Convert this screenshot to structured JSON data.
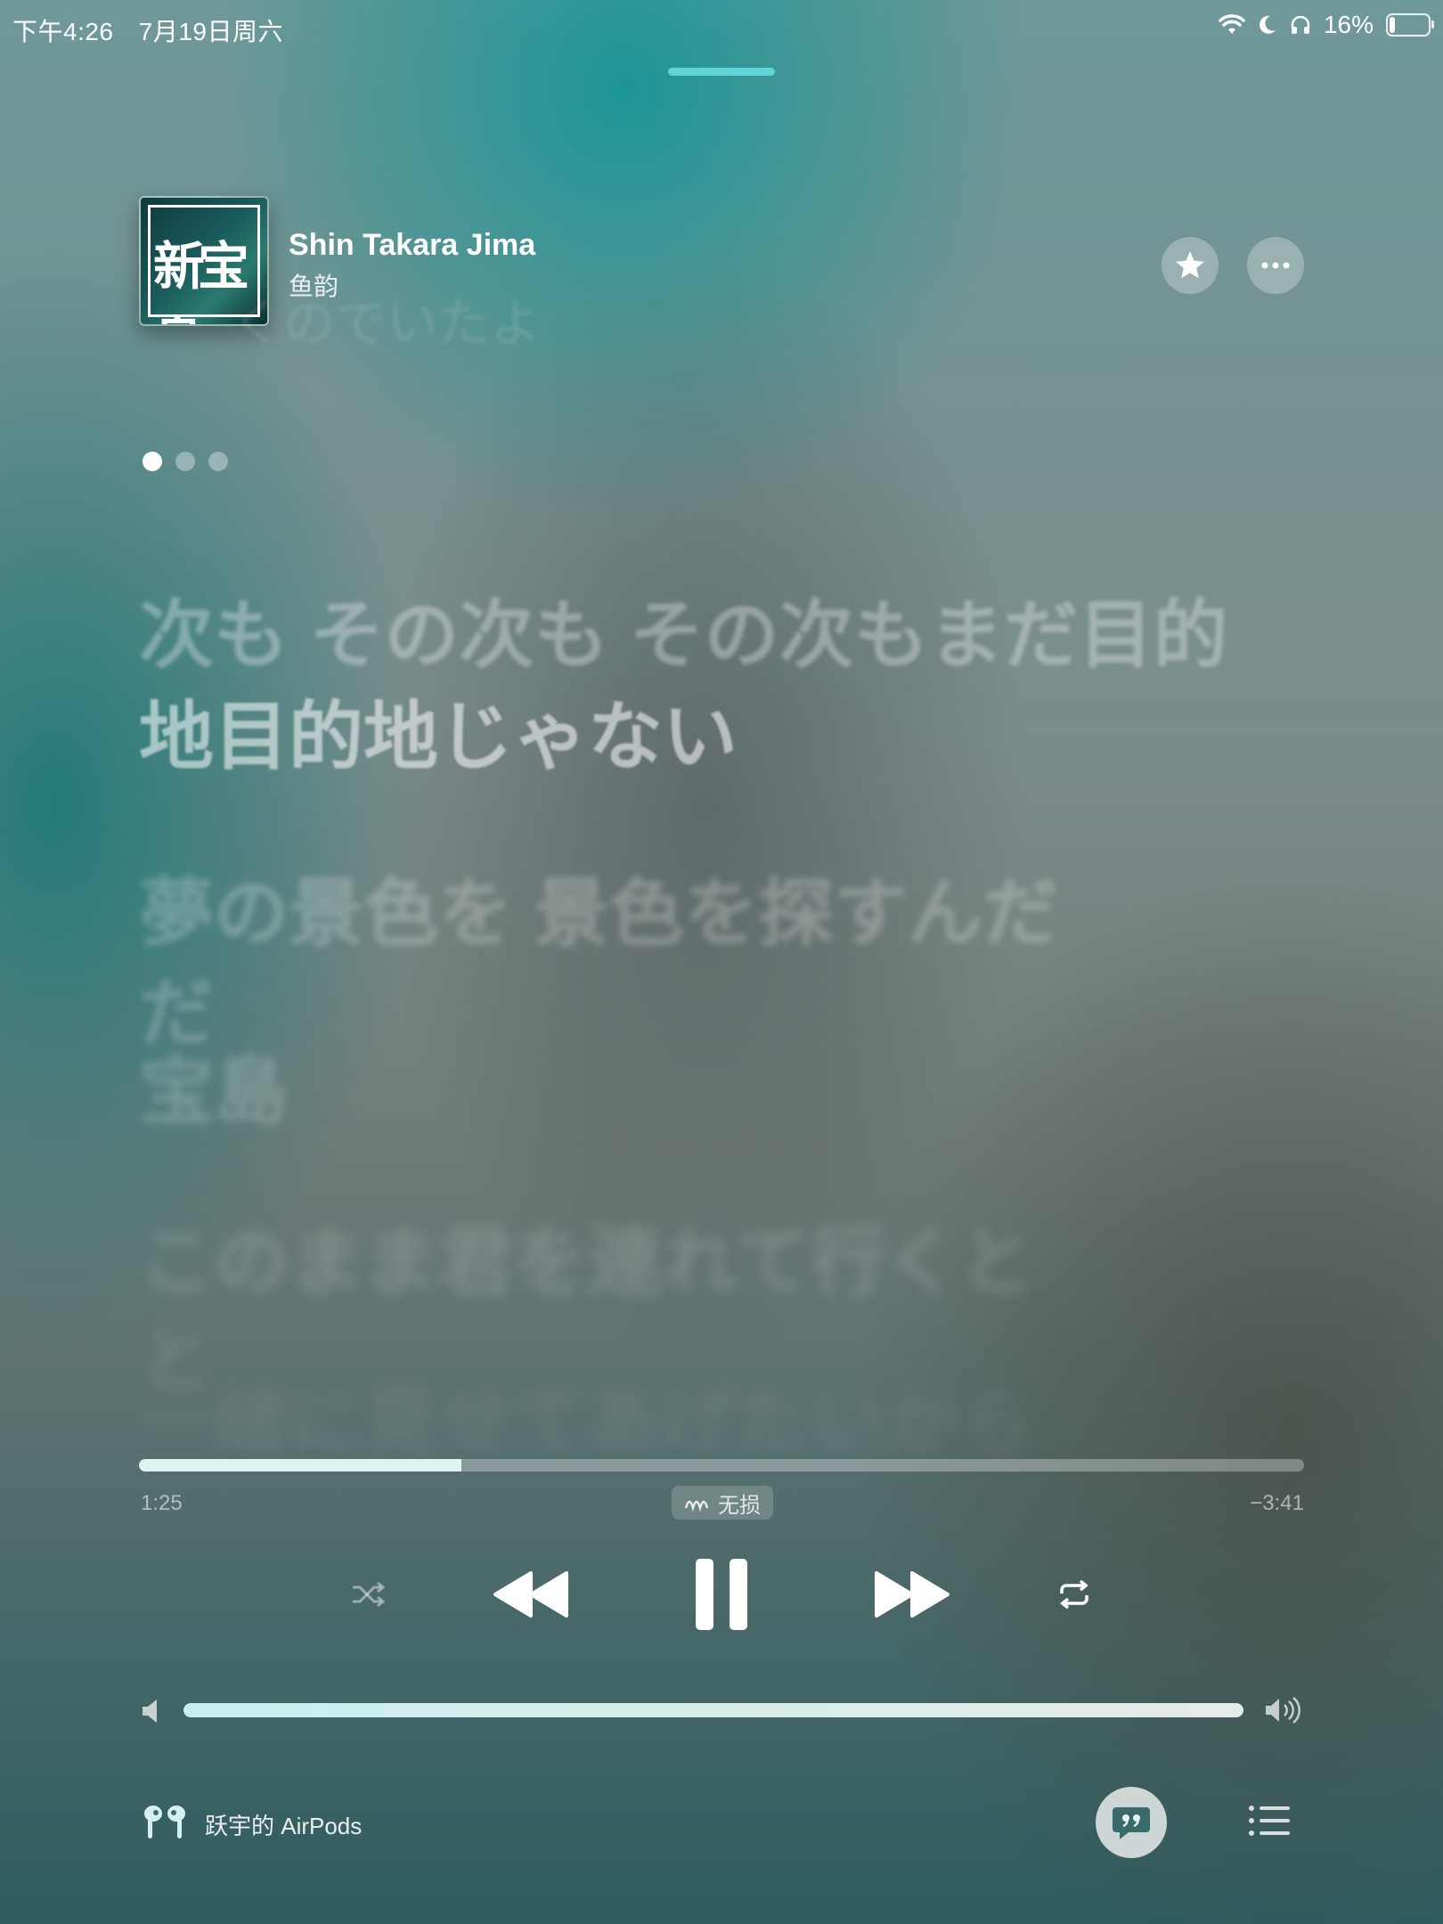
{
  "status_bar": {
    "time": "下午4:26",
    "date": "7月19日周六",
    "battery": "16%",
    "icons": [
      "wifi-icon",
      "moon-icon",
      "headphones-icon",
      "battery-icon"
    ]
  },
  "now_playing": {
    "title": "Shin Takara Jima",
    "artist": "鱼韵",
    "artwork_text": "新宝島",
    "ghost_lyric": "くのでいたよ"
  },
  "page_dots": {
    "count": 3,
    "active_index": 0
  },
  "lyrics": {
    "line1": "次も その次も その次もまだ目的",
    "line2": "地目的地じゃない",
    "line3": "夢の景色を 景色を探すんだ",
    "line3_wrap": "だ",
    "line3_next": "宝島",
    "line4": "このまま君を連れて行くと",
    "line4_wrap": "と",
    "line5": "一緒に見せてあげたいから"
  },
  "playback": {
    "elapsed": "1:25",
    "remaining": "−3:41",
    "progress_fraction": 0.277,
    "quality_label": "无损"
  },
  "volume": {
    "level_fraction": 1.0
  },
  "output_device": {
    "label": "跃宇的 AirPods"
  },
  "colors": {
    "accent_grabber": "#63d4d6",
    "progress_fill": "#dff3f1",
    "volume_fill": "#c9efee"
  }
}
